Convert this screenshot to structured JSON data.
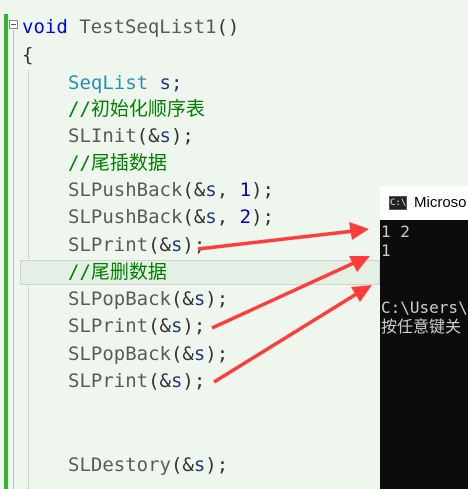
{
  "editor": {
    "lines": [
      {
        "keyword": "void",
        "name": " TestSeqList1",
        "rest": "()"
      },
      {
        "text": "{"
      },
      {
        "type": "SeqList",
        "rest": " s;"
      },
      {
        "comment": "//初始化顺序表"
      },
      {
        "fn": "SLInit",
        "open": "(&",
        "var": "s",
        "close": ");"
      },
      {
        "comment": "//尾插数据"
      },
      {
        "fn": "SLPushBack",
        "open": "(&",
        "var": "s",
        "mid": ", ",
        "num": "1",
        "close": ");"
      },
      {
        "fn": "SLPushBack",
        "open": "(&",
        "var": "s",
        "mid": ", ",
        "num": "2",
        "close": ");"
      },
      {
        "fn": "SLPrint",
        "open": "(&",
        "var": "s",
        "close": ");"
      },
      {
        "comment": "//尾删数据"
      },
      {
        "fn": "SLPopBack",
        "open": "(&",
        "var": "s",
        "close": ");"
      },
      {
        "fn": "SLPrint",
        "open": "(&",
        "var": "s",
        "close": ");"
      },
      {
        "fn": "SLPopBack",
        "open": "(&",
        "var": "s",
        "close": ");"
      },
      {
        "fn": "SLPrint",
        "open": "(&",
        "var": "s",
        "close": ");"
      },
      {
        "fn": "SLDestory",
        "open": "(&",
        "var": "s",
        "close": ");"
      }
    ]
  },
  "console": {
    "icon_label": "C:\\",
    "title": "Microso",
    "output": [
      "1 2",
      "1",
      "",
      "",
      "C:\\Users\\",
      "按任意键关"
    ]
  },
  "colors": {
    "arrow": "#ff3b3b",
    "editor_bg": "#eef6ee",
    "console_bg": "#0c0c0c"
  }
}
